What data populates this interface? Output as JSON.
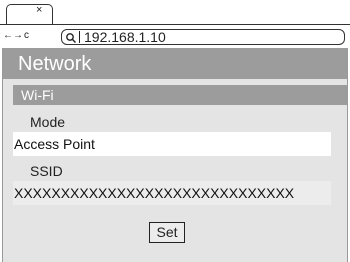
{
  "browser": {
    "tab": {
      "close_symbol": "×"
    },
    "nav": {
      "back": "←",
      "forward": "→",
      "reload": "c"
    },
    "url": "192.168.1.10",
    "search_icon": "search-icon"
  },
  "page": {
    "header_title": "Network",
    "section_title": "Wi-Fi",
    "mode": {
      "label": "Mode",
      "value": "Access Point"
    },
    "ssid": {
      "label": "SSID",
      "value": "XXXXXXXXXXXXXXXXXXXXXXXXXXXXXX"
    },
    "set_button": "Set"
  },
  "colors": {
    "header_bg": "#9c9c9c",
    "page_bg": "#e4e4e4",
    "header_text": "#ffffff"
  }
}
